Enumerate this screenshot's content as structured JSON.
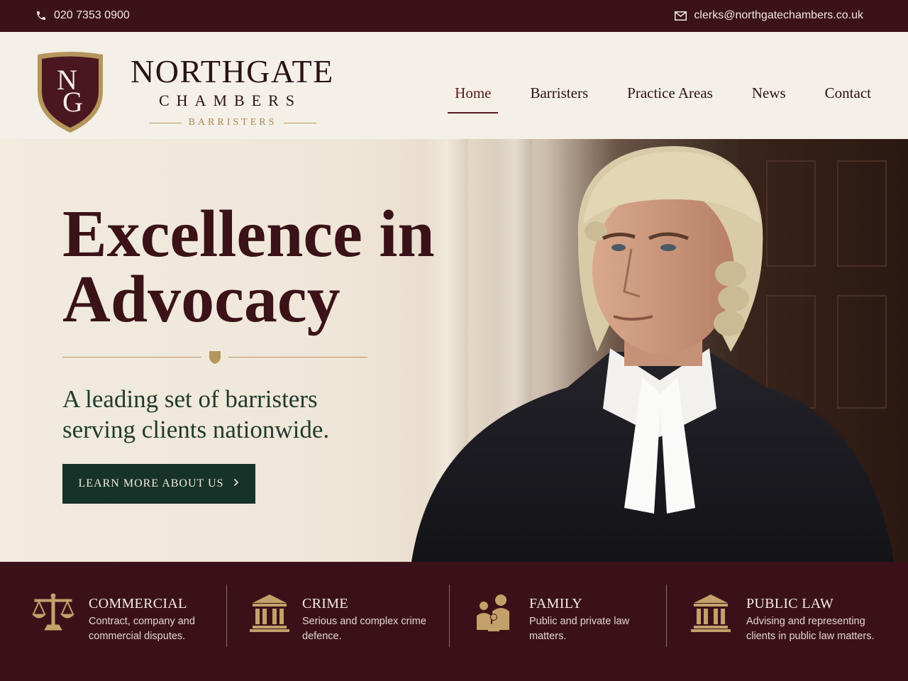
{
  "topbar": {
    "phone": "020 7353 0900",
    "email": "clerks@northgatechambers.co.uk"
  },
  "brand": {
    "crest_letters": "NG",
    "name": "NORTHGATE",
    "sub": "CHAMBERS",
    "tag": "BARRISTERS"
  },
  "nav": {
    "items": [
      {
        "label": "Home",
        "active": true
      },
      {
        "label": "Barristers"
      },
      {
        "label": "Practice Areas"
      },
      {
        "label": "News"
      },
      {
        "label": "Contact"
      }
    ]
  },
  "hero": {
    "title_line1": "Excellence in",
    "title_line2": "Advocacy",
    "subtitle_line1": "A leading set of barristers",
    "subtitle_line2": "serving clients nationwide.",
    "cta_label": "LEARN MORE ABOUT US",
    "cta_icon": "chevron-right-icon"
  },
  "practice_areas": [
    {
      "title": "COMMERCIAL",
      "desc": "Contract, company and commercial disputes.",
      "icon": "scales-icon"
    },
    {
      "title": "CRIME",
      "desc": "Serious and complex crime defence.",
      "icon": "courthouse-icon"
    },
    {
      "title": "FAMILY",
      "desc": "Public and private law matters.",
      "icon": "family-icon"
    },
    {
      "title": "PUBLIC LAW",
      "desc": "Advising and representing clients in public law matters.",
      "icon": "courthouse-icon"
    }
  ],
  "colors": {
    "burgundy": "#3b1119",
    "gold": "#b4955d",
    "dark_green": "#173228",
    "cream": "#f4efe7"
  }
}
